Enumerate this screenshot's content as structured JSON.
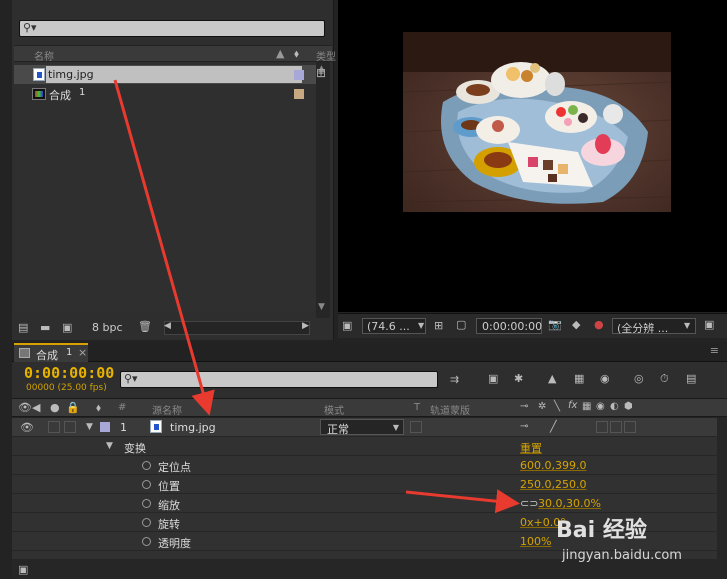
{
  "project_panel": {
    "search_placeholder": "⚲▾",
    "col_name": "名称",
    "col_type": "类型",
    "items": [
      {
        "name": "timg.jpg",
        "kind": "footage",
        "label_color": "#a8a8d8",
        "selected": true
      },
      {
        "name": "合成",
        "suffix": "1",
        "kind": "composition",
        "label_color": "#c8a880",
        "selected": false
      }
    ],
    "bit_depth": "8 bpc"
  },
  "viewer": {
    "zoom": "(74.6 ...",
    "timecode": "0:00:00:00",
    "resolution": "(全分辨 ...",
    "image_alt": "photo of tea and desserts on a wooden table"
  },
  "timeline": {
    "tab_label": "合成",
    "tab_number": "1",
    "current_time": "0:00:00:00",
    "frame_info": "00000 (25.00 fps)",
    "search_placeholder": "⚲▾",
    "headers": {
      "hash": "#",
      "source_name": "源名称",
      "mode": "模式",
      "t": "T",
      "trkmat": "轨道蒙版"
    },
    "layer": {
      "index": "1",
      "name": "timg.jpg",
      "mode": "正常",
      "label_color": "#a8a8d8"
    },
    "transform_label": "变换",
    "reset_label": "重置",
    "properties": [
      {
        "name": "定位点",
        "value": "600.0,399.0"
      },
      {
        "name": "位置",
        "value": "250.0,250.0"
      },
      {
        "name": "缩放",
        "value": "30.0,30.0%"
      },
      {
        "name": "旋转",
        "value": "0x+0.0°"
      },
      {
        "name": "透明度",
        "value": "100%"
      }
    ]
  },
  "watermark": {
    "text": "Bai 经验",
    "url": "jingyan.baidu.com"
  },
  "colors": {
    "timecode": "#e8b300",
    "value": "#d6a400",
    "arrow": "#e83a2e"
  }
}
